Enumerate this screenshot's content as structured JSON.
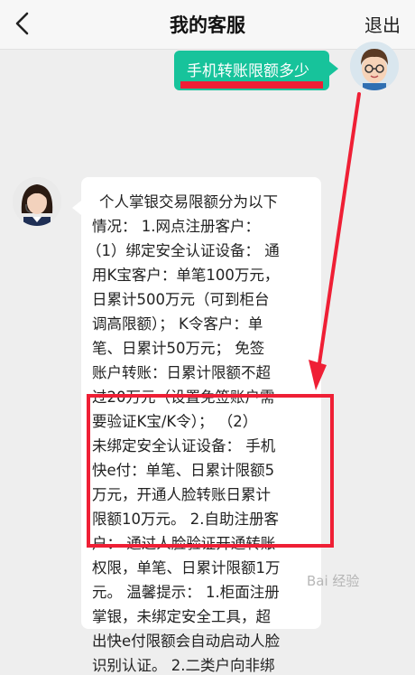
{
  "header": {
    "title": "我的客服",
    "exit_label": "退出",
    "back_icon": "chevron-left-icon"
  },
  "user_message": {
    "text": "手机转账限额多少",
    "bubble_color": "#17c39b"
  },
  "agent_message": {
    "lines": [
      "个人掌银交易限额分为以下",
      "情况： 1.网点注册客户：",
      "（1）绑定安全认证设备： 通",
      "用K宝客户：单笔100万元，",
      "日累计500万元（可到柜台",
      "调高限额）； K令客户：单",
      "笔、日累计50万元； 免签",
      "账户转账：日累计限额不超",
      "过20万元（设置免签账户需",
      "要验证K宝/K令）； （2）",
      "未绑定安全认证设备： 手机",
      "快e付：单笔、日累计限额5",
      "万元，开通人脸转账日累计",
      "限额10万元。 2.自助注册客",
      "户： 通过人脸验证开通转账",
      "权限，单笔、日累计限额1万",
      "元。 温馨提示： 1.柜面注册",
      "掌银，未绑定安全工具，超",
      "出快e付限额会自动启动人脸",
      "识别认证。 2.二类户向非绑"
    ]
  },
  "annotation": {
    "color": "#ef1f35"
  },
  "watermark": {
    "text": "Bai 经验"
  }
}
